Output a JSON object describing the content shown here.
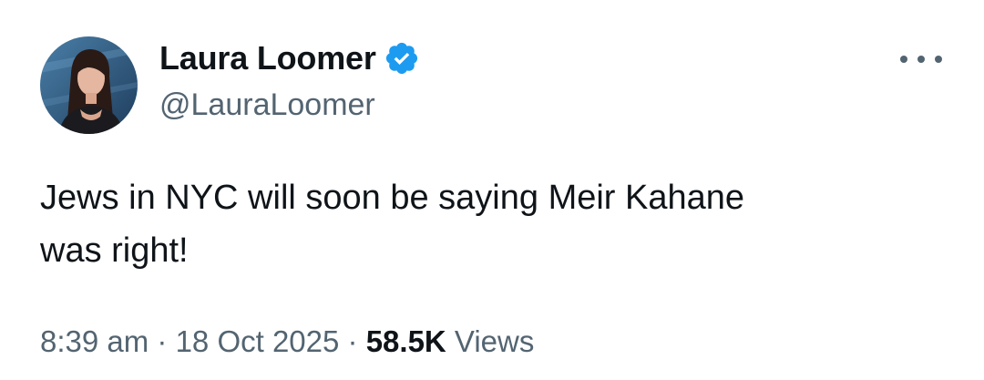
{
  "author": {
    "display_name": "Laura Loomer",
    "handle": "@LauraLoomer",
    "verified": true
  },
  "tweet": {
    "text_line1": "Jews in NYC will soon be saying Meir Kahane",
    "text_line2": "was right!"
  },
  "meta": {
    "time": "8:39 am",
    "separator1": " · ",
    "date": "18 Oct 2025",
    "separator2": " · ",
    "views_count": "58.5K",
    "views_label": " Views"
  },
  "icons": {
    "verified": "verified-badge-icon",
    "more": "more-options-icon"
  },
  "colors": {
    "verified_blue": "#1d9bf0",
    "text": "#0f1419",
    "secondary": "#536471"
  }
}
